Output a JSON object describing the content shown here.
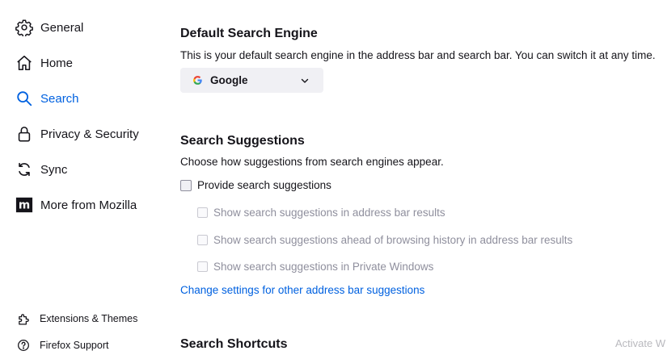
{
  "sidebar": {
    "items": [
      {
        "label": "General",
        "icon": "gear-icon"
      },
      {
        "label": "Home",
        "icon": "home-icon"
      },
      {
        "label": "Search",
        "icon": "search-icon",
        "selected": true
      },
      {
        "label": "Privacy & Security",
        "icon": "lock-icon"
      },
      {
        "label": "Sync",
        "icon": "sync-icon"
      },
      {
        "label": "More from Mozilla",
        "icon": "mozilla-icon"
      }
    ],
    "footer": [
      {
        "label": "Extensions & Themes",
        "icon": "puzzle-icon"
      },
      {
        "label": "Firefox Support",
        "icon": "help-icon"
      }
    ]
  },
  "default_engine": {
    "title": "Default Search Engine",
    "description": "This is your default search engine in the address bar and search bar. You can switch it at any time.",
    "selected": "Google"
  },
  "suggestions": {
    "title": "Search Suggestions",
    "description": "Choose how suggestions from search engines appear.",
    "provide_label": "Provide search suggestions",
    "provide_checked": false,
    "sub_options": [
      {
        "label": "Show search suggestions in address bar results",
        "checked": false,
        "disabled": true
      },
      {
        "label": "Show search suggestions ahead of browsing history in address bar results",
        "checked": false,
        "disabled": true
      },
      {
        "label": "Show search suggestions in Private Windows",
        "checked": false,
        "disabled": true
      }
    ],
    "link": "Change settings for other address bar suggestions"
  },
  "shortcuts": {
    "title": "Search Shortcuts"
  },
  "watermark": "Activate W",
  "colors": {
    "accent": "#0061e0",
    "text": "#15141a",
    "disabled_text": "#8f8f9d",
    "select_bg": "#f0f0f4"
  }
}
